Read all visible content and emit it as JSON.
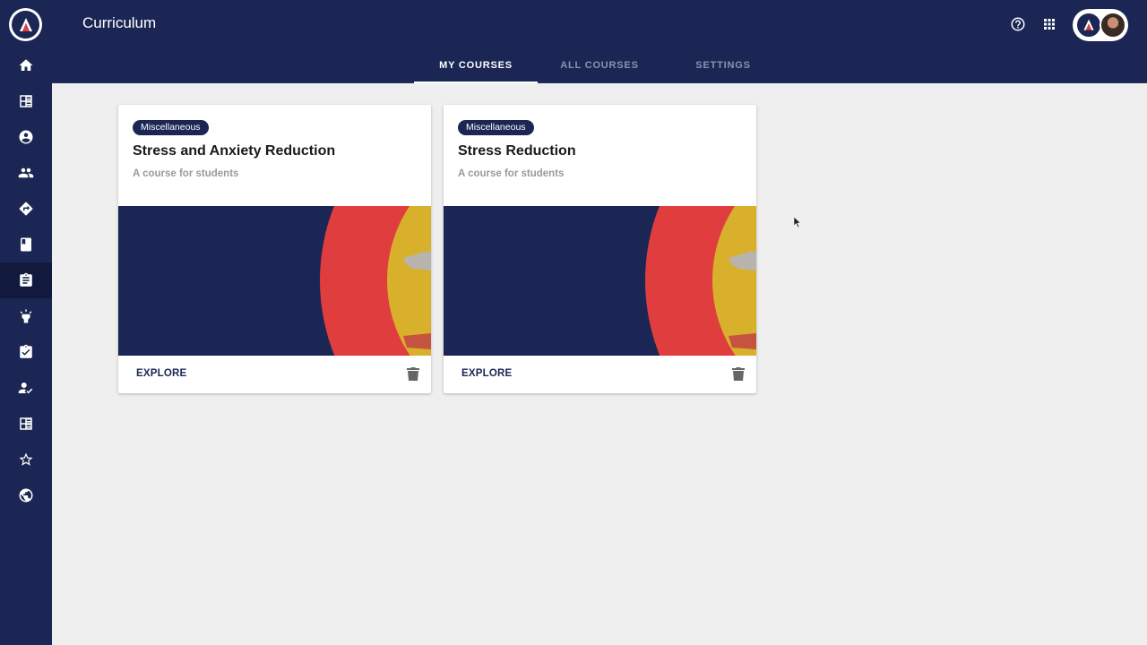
{
  "header": {
    "title": "Curriculum"
  },
  "tabs": [
    {
      "label": "MY COURSES",
      "active": true
    },
    {
      "label": "ALL COURSES",
      "active": false
    },
    {
      "label": "SETTINGS",
      "active": false
    }
  ],
  "sidebar": {
    "items": [
      {
        "icon": "home-icon"
      },
      {
        "icon": "dashboard-icon"
      },
      {
        "icon": "account-icon"
      },
      {
        "icon": "people-icon"
      },
      {
        "icon": "directions-icon"
      },
      {
        "icon": "book-icon"
      },
      {
        "icon": "assignment-icon",
        "active": true
      },
      {
        "icon": "lightbulb-icon"
      },
      {
        "icon": "assignment-check-icon"
      },
      {
        "icon": "person-check-icon"
      },
      {
        "icon": "list-alt-icon"
      },
      {
        "icon": "star-outline-icon"
      },
      {
        "icon": "globe-icon"
      }
    ]
  },
  "courses": [
    {
      "category": "Miscellaneous",
      "title": "Stress and Anxiety Reduction",
      "subtitle": "A course for students",
      "action": "EXPLORE"
    },
    {
      "category": "Miscellaneous",
      "title": "Stress Reduction",
      "subtitle": "A course for students",
      "action": "EXPLORE"
    }
  ],
  "colors": {
    "primary": "#1b2654",
    "accent_red": "#e03e3e",
    "accent_yellow": "#d9b02b",
    "background": "#efefef"
  }
}
